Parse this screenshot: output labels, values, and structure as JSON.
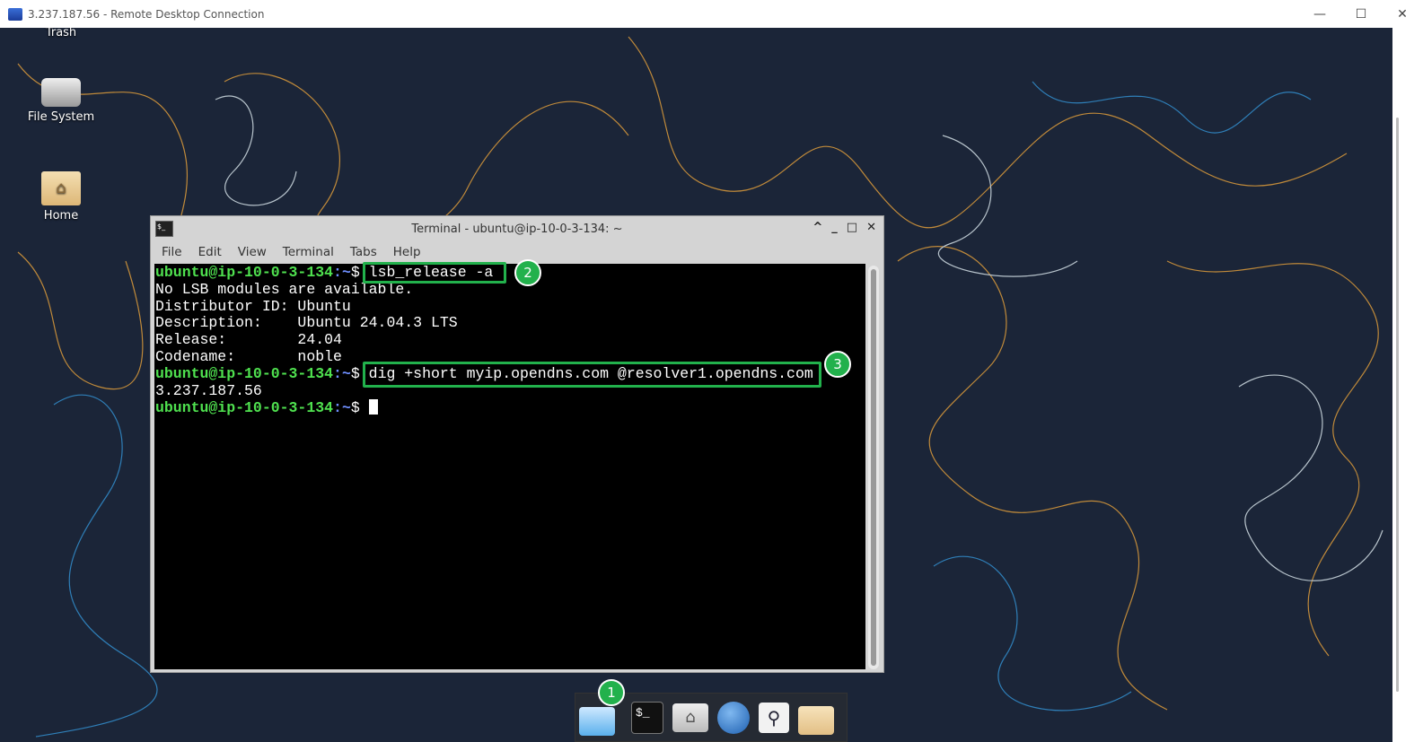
{
  "window": {
    "title": "3.237.187.56 - Remote Desktop Connection",
    "controls": [
      "minimize",
      "maximize",
      "close"
    ]
  },
  "desktop": {
    "icons": [
      {
        "label": "Trash"
      },
      {
        "label": "File System"
      },
      {
        "label": "Home"
      }
    ]
  },
  "terminal": {
    "title": "Terminal - ubuntu@ip-10-0-3-134: ~",
    "menu": [
      "File",
      "Edit",
      "View",
      "Terminal",
      "Tabs",
      "Help"
    ],
    "prompt_user": "ubuntu@ip-10-0-3-134",
    "prompt_path": ":~",
    "prompt_sym": "$ ",
    "cmd1": "lsb_release -a",
    "out1": [
      "No LSB modules are available.",
      "Distributor ID: Ubuntu",
      "Description:    Ubuntu 24.04.3 LTS",
      "Release:        24.04",
      "Codename:       noble"
    ],
    "cmd2": "dig +short myip.opendns.com @resolver1.opendns.com",
    "out2": "3.237.187.56"
  },
  "annotations": [
    "1",
    "2",
    "3"
  ],
  "accent": "#22b14c",
  "dock": [
    "show-desktop",
    "terminal",
    "home-folder",
    "web-browser",
    "app-finder",
    "file-manager"
  ]
}
